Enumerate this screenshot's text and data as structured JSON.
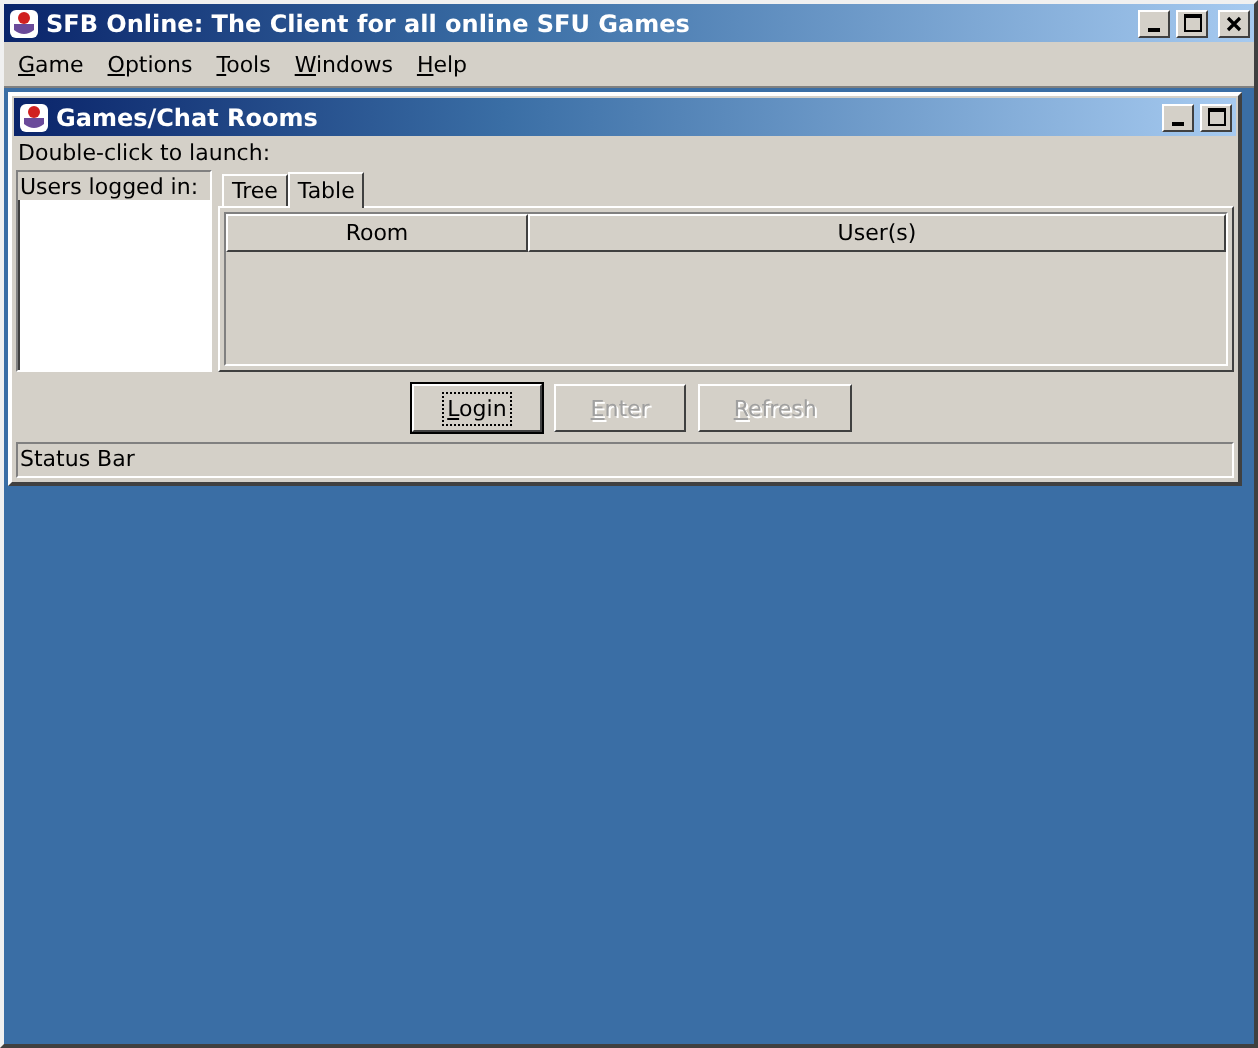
{
  "window": {
    "title": "SFB Online: The Client for all online SFU Games"
  },
  "menu": [
    {
      "label": "Game"
    },
    {
      "label": "Options"
    },
    {
      "label": "Tools"
    },
    {
      "label": "Windows"
    },
    {
      "label": "Help"
    }
  ],
  "frame": {
    "title": "Games/Chat Rooms",
    "hint": "Double-click to launch:",
    "users_list": {
      "header": "Users logged in:"
    },
    "tabs": [
      {
        "label": "Tree",
        "selected": false
      },
      {
        "label": "Table",
        "selected": true
      }
    ],
    "table": {
      "columns": [
        "Room",
        "User(s)"
      ]
    },
    "buttons": [
      {
        "label": "Login",
        "disabled": false,
        "focused": true
      },
      {
        "label": "Enter",
        "disabled": true,
        "focused": false
      },
      {
        "label": "Refresh",
        "disabled": true,
        "focused": false
      }
    ],
    "status_bar": "Status Bar"
  }
}
